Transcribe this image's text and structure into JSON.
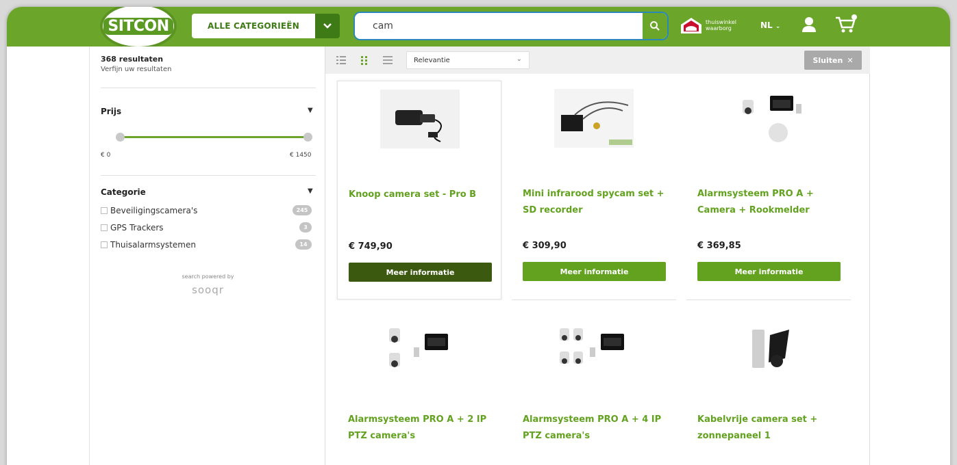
{
  "header": {
    "logo_text": "SITCON",
    "category_label": "ALLE CATEGORIEËN",
    "search_value": "cam",
    "thuiswinkel_line1": "thuiswinkel",
    "thuiswinkel_line2": "waarborg",
    "language": "NL"
  },
  "sidebar": {
    "results_count": "368 resultaten",
    "refine_label": "Verfijn uw resultaten",
    "price_title": "Prijs",
    "price_min": "€ 0",
    "price_max": "€ 1450",
    "category_title": "Categorie",
    "categories": [
      {
        "label": "Beveiligingscamera's",
        "count": "245"
      },
      {
        "label": "GPS Trackers",
        "count": "3"
      },
      {
        "label": "Thuisalarmsystemen",
        "count": "14"
      }
    ],
    "powered_by": "search powered by",
    "powered_brand": "sooqr"
  },
  "toolbar": {
    "sort_value": "Relevantie",
    "close_label": "Sluiten"
  },
  "products": [
    {
      "title": "Knoop camera set - Pro B",
      "price": "€ 749,90",
      "button": "Meer informatie"
    },
    {
      "title": "Mini infrarood spycam set + SD recorder",
      "price": "€ 309,90",
      "button": "Meer informatie"
    },
    {
      "title": "Alarmsysteem PRO A + Camera + Rookmelder",
      "price": "€ 369,85",
      "button": "Meer informatie"
    },
    {
      "title": "Alarmsysteem PRO A + 2 IP PTZ camera's"
    },
    {
      "title": "Alarmsysteem PRO A + 4 IP PTZ camera's"
    },
    {
      "title": "Kabelvrije camera set + zonnepaneel 1"
    }
  ],
  "colors": {
    "brand_green": "#6ba52a",
    "dark_green": "#3b5a10",
    "title_green": "#62a21f"
  }
}
